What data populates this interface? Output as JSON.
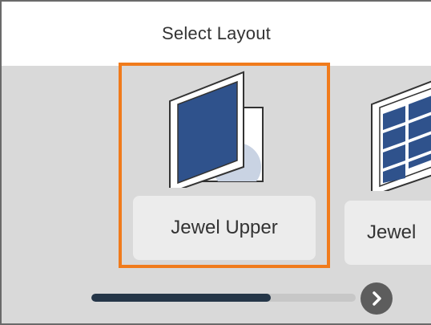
{
  "header": {
    "title": "Select Layout"
  },
  "layouts": {
    "selected": {
      "label": "Jewel Upper",
      "icon": "jewel-upper-layout-icon"
    },
    "next": {
      "label": "Jewel",
      "icon": "jewel-index-layout-icon"
    }
  },
  "scroll": {
    "progress": 0.68
  },
  "navigation": {
    "next_icon": "chevron-right-icon"
  },
  "colors": {
    "selection_border": "#f07b1c",
    "layout_blue": "#2f528c",
    "progress_fill": "#253648",
    "background": "#d9d9d9"
  }
}
